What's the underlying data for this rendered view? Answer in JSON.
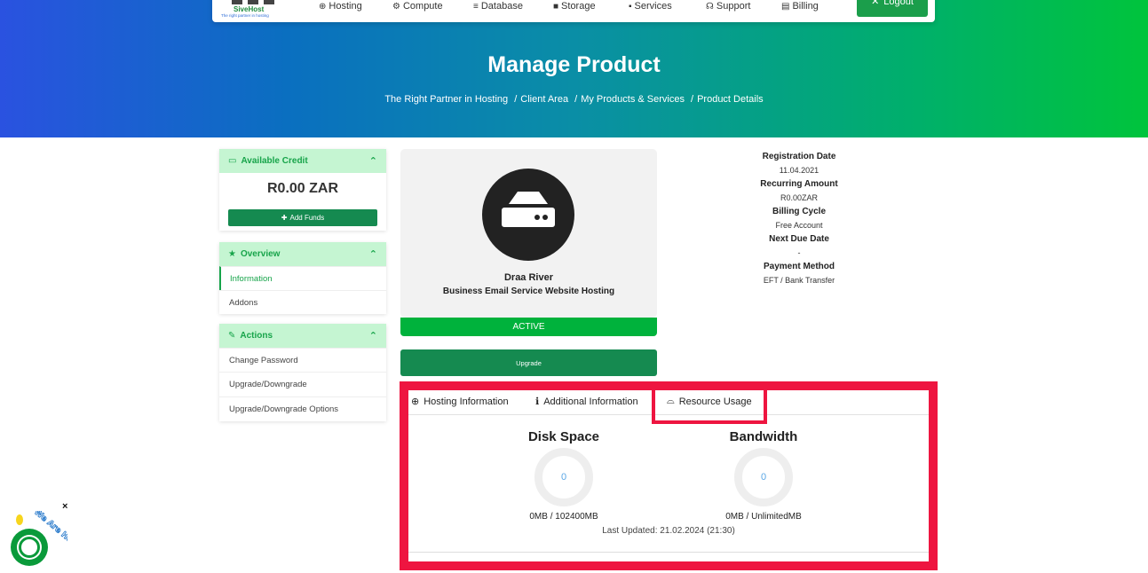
{
  "nav": {
    "logo_name": "SiveHost",
    "logo_tagline": "The right partner in hosting",
    "items": [
      {
        "label": "Hosting",
        "icon": "globe-icon"
      },
      {
        "label": "Compute",
        "icon": "cpu-icon"
      },
      {
        "label": "Database",
        "icon": "database-icon"
      },
      {
        "label": "Storage",
        "icon": "box-icon"
      },
      {
        "label": "Services",
        "icon": "gift-icon"
      },
      {
        "label": "Support",
        "icon": "headset-icon"
      },
      {
        "label": "Billing",
        "icon": "receipt-icon"
      }
    ],
    "logout_label": "Logout"
  },
  "hero": {
    "title": "Manage Product",
    "breadcrumb": [
      "The Right Partner in Hosting",
      "Client Area",
      "My Products & Services",
      "Product Details"
    ]
  },
  "sidebar": {
    "credit": {
      "title": "Available Credit",
      "value": "R0.00 ZAR",
      "add_funds_label": "Add Funds"
    },
    "overview": {
      "title": "Overview",
      "items": [
        "Information",
        "Addons"
      ]
    },
    "actions": {
      "title": "Actions",
      "items": [
        "Change Password",
        "Upgrade/Downgrade",
        "Upgrade/Downgrade Options"
      ]
    }
  },
  "product": {
    "name": "Draa River",
    "group": "Business Email Service Website Hosting",
    "status": "ACTIVE",
    "upgrade_label": "Upgrade"
  },
  "details": {
    "registration_date_label": "Registration Date",
    "registration_date": "11.04.2021",
    "recurring_amount_label": "Recurring Amount",
    "recurring_amount": "R0.00ZAR",
    "billing_cycle_label": "Billing Cycle",
    "billing_cycle": "Free Account",
    "next_due_label": "Next Due Date",
    "next_due": "-",
    "payment_method_label": "Payment Method",
    "payment_method": "EFT / Bank Transfer"
  },
  "tabs": {
    "items": [
      "Hosting Information",
      "Additional Information",
      "Resource Usage"
    ],
    "active": "Resource Usage"
  },
  "resources": {
    "disk": {
      "title": "Disk Space",
      "gauge": "0",
      "usage": "0MB / 102400MB"
    },
    "bandwidth": {
      "title": "Bandwidth",
      "gauge": "0",
      "usage": "0MB / UnlimitedMB"
    },
    "last_updated": "Last Updated: 21.02.2024 (21:30)"
  },
  "chat": {
    "label": "We Are Here!",
    "close": "×"
  },
  "colors": {
    "accent": "#17a44a",
    "active_status": "#00b23c",
    "button": "#158a50",
    "highlight": "#ee1540"
  }
}
